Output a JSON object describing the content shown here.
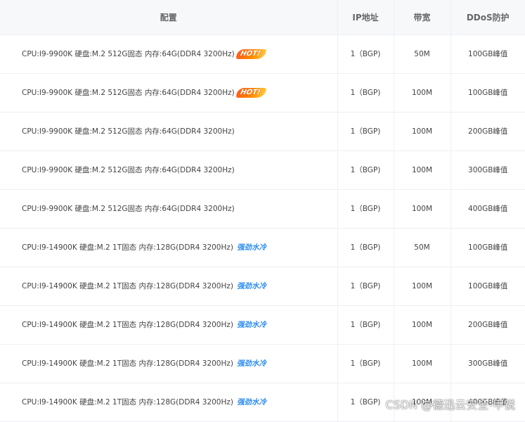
{
  "table": {
    "headers": {
      "config": "配置",
      "ip": "IP地址",
      "bandwidth": "带宽",
      "ddos": "DDoS防护"
    },
    "rows": [
      {
        "config": "CPU:I9-9900K 硬盘:M.2 512G固态 内存:64G(DDR4 3200Hz)",
        "tag": "HOT!",
        "tag_type": "hot",
        "ip": "1（BGP)",
        "bandwidth": "50M",
        "ddos": "100GB峰值"
      },
      {
        "config": "CPU:I9-9900K 硬盘:M.2 512G固态 内存:64G(DDR4 3200Hz)",
        "tag": "HOT!",
        "tag_type": "hot",
        "ip": "1（BGP)",
        "bandwidth": "100M",
        "ddos": "100GB峰值"
      },
      {
        "config": "CPU:I9-9900K 硬盘:M.2 512G固态 内存:64G(DDR4 3200Hz)",
        "tag": "",
        "tag_type": "none",
        "ip": "1（BGP)",
        "bandwidth": "100M",
        "ddos": "200GB峰值"
      },
      {
        "config": "CPU:I9-9900K 硬盘:M.2 512G固态 内存:64G(DDR4 3200Hz)",
        "tag": "",
        "tag_type": "none",
        "ip": "1（BGP)",
        "bandwidth": "100M",
        "ddos": "300GB峰值"
      },
      {
        "config": "CPU:I9-9900K 硬盘:M.2 512G固态 内存:64G(DDR4 3200Hz)",
        "tag": "",
        "tag_type": "none",
        "ip": "1（BGP)",
        "bandwidth": "100M",
        "ddos": "400GB峰值"
      },
      {
        "config": "CPU:I9-14900K 硬盘:M.2 1T固态 内存:128G(DDR4 3200Hz)",
        "tag": "强劲水冷",
        "tag_type": "water",
        "ip": "1（BGP)",
        "bandwidth": "50M",
        "ddos": "100GB峰值"
      },
      {
        "config": "CPU:I9-14900K 硬盘:M.2 1T固态 内存:128G(DDR4 3200Hz)",
        "tag": "强劲水冷",
        "tag_type": "water",
        "ip": "1（BGP)",
        "bandwidth": "100M",
        "ddos": "100GB峰值"
      },
      {
        "config": "CPU:I9-14900K 硬盘:M.2 1T固态 内存:128G(DDR4 3200Hz)",
        "tag": "强劲水冷",
        "tag_type": "water",
        "ip": "1（BGP)",
        "bandwidth": "100M",
        "ddos": "200GB峰值"
      },
      {
        "config": "CPU:I9-14900K 硬盘:M.2 1T固态 内存:128G(DDR4 3200Hz)",
        "tag": "强劲水冷",
        "tag_type": "water",
        "ip": "1（BGP)",
        "bandwidth": "100M",
        "ddos": "300GB峰值"
      },
      {
        "config": "CPU:I9-14900K 硬盘:M.2 1T固态 内存:128G(DDR4 3200Hz)",
        "tag": "强劲水冷",
        "tag_type": "water",
        "ip": "1（BGP)",
        "bandwidth": "100M",
        "ddos": "400GB峰值"
      }
    ]
  },
  "watermark": "CSDN @德迅云安全-甲锐",
  "colors": {
    "header_bg": "#f7f8fa",
    "border": "#eceff3",
    "tag_blue": "#2b8cef",
    "hot_orange": "#ff6a00"
  }
}
